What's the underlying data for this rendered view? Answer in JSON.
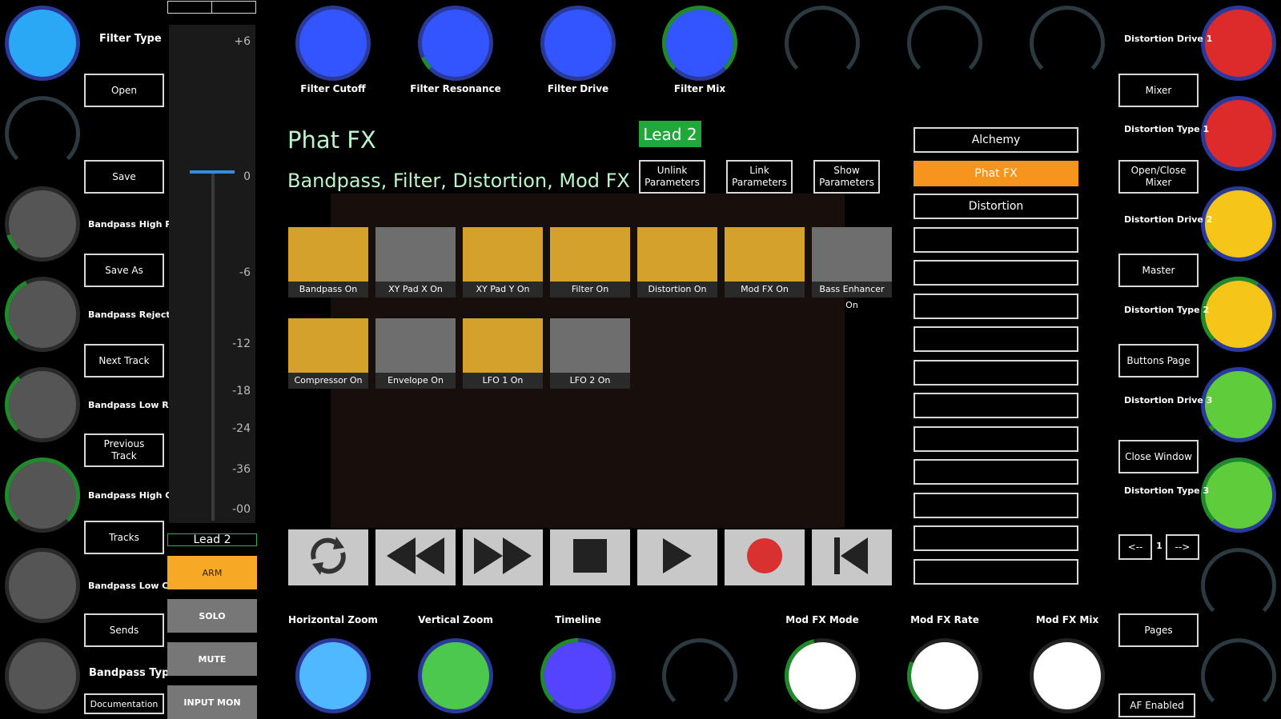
{
  "header": {
    "plugin_title": "Phat FX",
    "plugin_subtitle": "Bandpass, Filter, Distortion, Mod FX",
    "track_badge": "Lead 2"
  },
  "param_buttons": [
    "Unlink\nParameters",
    "Link\nParameters",
    "Show\nParameters"
  ],
  "top_knobs": [
    {
      "label": "Filter Cutoff",
      "color": "#3355ff",
      "value": 0.0
    },
    {
      "label": "Filter Resonance",
      "color": "#3355ff",
      "value": 0.08
    },
    {
      "label": "Filter Drive",
      "color": "#3355ff",
      "value": 0.0
    },
    {
      "label": "Filter Mix",
      "color": "#3355ff",
      "value": 1.0
    },
    {
      "label": "",
      "color": "",
      "value": 0
    },
    {
      "label": "",
      "color": "",
      "value": 0
    },
    {
      "label": "",
      "color": "",
      "value": 0
    }
  ],
  "bottom_knobs": [
    {
      "label": "Horizontal Zoom",
      "color": "#4fb8ff",
      "value": 0.0
    },
    {
      "label": "Vertical Zoom",
      "color": "#4cc94c",
      "value": 0.0
    },
    {
      "label": "Timeline",
      "color": "#5544ff",
      "value": 0.5
    },
    {
      "label": "",
      "color": "",
      "value": 0
    },
    {
      "label": "Mod FX Mode",
      "color": "#ffffff",
      "value": 0.45
    },
    {
      "label": "Mod FX Rate",
      "color": "#ffffff",
      "value": 0.25
    },
    {
      "label": "Mod FX Mix",
      "color": "#ffffff",
      "value": 0.0
    }
  ],
  "left_knobs": [
    {
      "label": "Filter Type",
      "color": "#2aa7f5",
      "value": 0.0
    },
    {
      "label": "",
      "color": "",
      "value": 0
    },
    {
      "label": "Bandpass High Res...",
      "color": "#555555",
      "value": 0.1
    },
    {
      "label": "Bandpass Reject Mix",
      "color": "#555555",
      "value": 0.4
    },
    {
      "label": "Bandpass Low Reso...",
      "color": "#555555",
      "value": 0.35
    },
    {
      "label": "Bandpass High Cutoff",
      "color": "#555555",
      "value": 1.0
    },
    {
      "label": "Bandpass Low Cutoff",
      "color": "#555555",
      "value": 0.0
    },
    {
      "label": "Bandpass Type",
      "color": "#555555",
      "value": 0
    }
  ],
  "left_buttons": [
    "Open",
    "Save",
    "Save As",
    "Next Track",
    "Previous\nTrack",
    "Tracks",
    "Sends",
    "Documentation"
  ],
  "right_knobs": [
    {
      "label": "Distortion Drive 1",
      "color": "#dd2b2b",
      "value": 0.0
    },
    {
      "label": "Distortion Type 1",
      "color": "#dd2b2b",
      "value": 0.0
    },
    {
      "label": "Distortion Drive 2",
      "color": "#f5c518",
      "value": 0.05
    },
    {
      "label": "Distortion Type 2",
      "color": "#f5c518",
      "value": 0.62
    },
    {
      "label": "Distortion Drive 3",
      "color": "#5fcc3c",
      "value": 0.03
    },
    {
      "label": "Distortion Type 3",
      "color": "#5fcc3c",
      "value": 0.72
    },
    {
      "label": "",
      "color": "",
      "value": 0
    },
    {
      "label": "",
      "color": "",
      "value": 0
    }
  ],
  "right_buttons": [
    "Mixer",
    "Open/Close\nMixer",
    "Master",
    "Buttons Page",
    "Close Window",
    "Pages",
    "AF Enabled"
  ],
  "pager": {
    "prev": "<--",
    "page": "1",
    "next": "-->"
  },
  "plugin_list": [
    "Alchemy",
    "Phat FX",
    "Distortion",
    "",
    "",
    "",
    "",
    "",
    "",
    "",
    "",
    "",
    "",
    ""
  ],
  "plugin_list_active": 1,
  "pads_row1": [
    {
      "label": "Bandpass On",
      "on": true
    },
    {
      "label": "XY Pad X On",
      "on": false
    },
    {
      "label": "XY Pad Y On",
      "on": true
    },
    {
      "label": "Filter On",
      "on": true
    },
    {
      "label": "Distortion On",
      "on": true
    },
    {
      "label": "Mod FX On",
      "on": true
    },
    {
      "label": "Bass Enhancer On",
      "on": false
    }
  ],
  "pads_row2": [
    {
      "label": "Compressor On",
      "on": true
    },
    {
      "label": "Envelope On",
      "on": false
    },
    {
      "label": "LFO 1 On",
      "on": true
    },
    {
      "label": "LFO 2 On",
      "on": false
    }
  ],
  "transport": [
    "loop-icon",
    "rewind-icon",
    "fast-forward-icon",
    "stop-icon",
    "play-icon",
    "record-icon",
    "go-to-start-icon"
  ],
  "fader": {
    "scale": [
      "+6",
      "0",
      "-6",
      "-12",
      "-18",
      "-24",
      "-36",
      "-00"
    ],
    "level_db": 0,
    "track_name": "Lead 2"
  },
  "track_buttons": [
    "ARM",
    "SOLO",
    "MUTE",
    "INPUT MON"
  ],
  "colors": {
    "pad_on": "#d4a22a",
    "pad_off": "#6e6e6e",
    "active_list": "#f7941d",
    "badge": "#22a83a",
    "title": "#b9f5c8"
  }
}
